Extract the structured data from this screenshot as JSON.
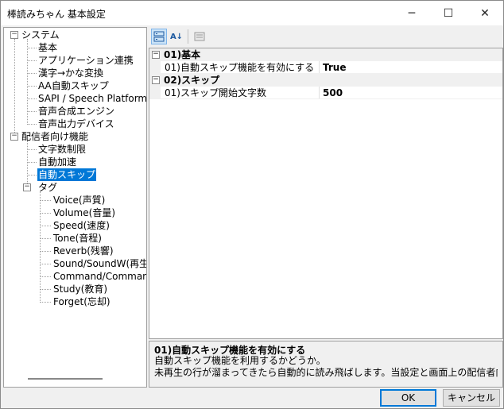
{
  "window": {
    "title": "棒読みちゃん 基本設定"
  },
  "titlebar": {
    "minimize_icon": "─",
    "maximize_icon": "☐",
    "close_icon": "✕"
  },
  "tree": {
    "system": {
      "label": "システム",
      "children": [
        "基本",
        "アプリケーション連携",
        "漢字→かな変換",
        "AA自動スキップ",
        "SAPI / Speech Platform",
        "音声合成エンジン",
        "音声出力デバイス"
      ]
    },
    "broadcaster": {
      "label": "配信者向け機能",
      "children": [
        "文字数制限",
        "自動加速",
        "自動スキップ"
      ],
      "selected": "自動スキップ",
      "tag": {
        "label": "タグ",
        "children": [
          "Voice(声質)",
          "Volume(音量)",
          "Speed(速度)",
          "Tone(音程)",
          "Reverb(残響)",
          "Sound/SoundW(再生)",
          "Command/CommandW(",
          "Study(教育)",
          "Forget(忘却)"
        ]
      }
    },
    "expander_minus": "−"
  },
  "toolbar": {
    "categorized_icon": "categorized-icon",
    "alphabetical_label": "A↓",
    "property_pages_icon": "property-pages-icon"
  },
  "grid": {
    "categories": [
      {
        "label": "01)基本",
        "toggle": "−",
        "props": [
          {
            "name": "01)自動スキップ機能を有効にする",
            "value": "True"
          }
        ]
      },
      {
        "label": "02)スキップ",
        "toggle": "−",
        "props": [
          {
            "name": "01)スキップ開始文字数",
            "value": "500"
          }
        ]
      }
    ]
  },
  "help": {
    "title": "01)自動スキップ機能を有効にする",
    "description": "自動スキップ機能を利用するかどうか。\n未再生の行が溜まってきたら自動的に読み飛ばします。当設定と画面上の配信者向け機..."
  },
  "buttons": {
    "ok": "OK",
    "cancel": "キャンセル"
  },
  "colors": {
    "selection": "#0078d7",
    "default_button_border": "#0078d7"
  }
}
